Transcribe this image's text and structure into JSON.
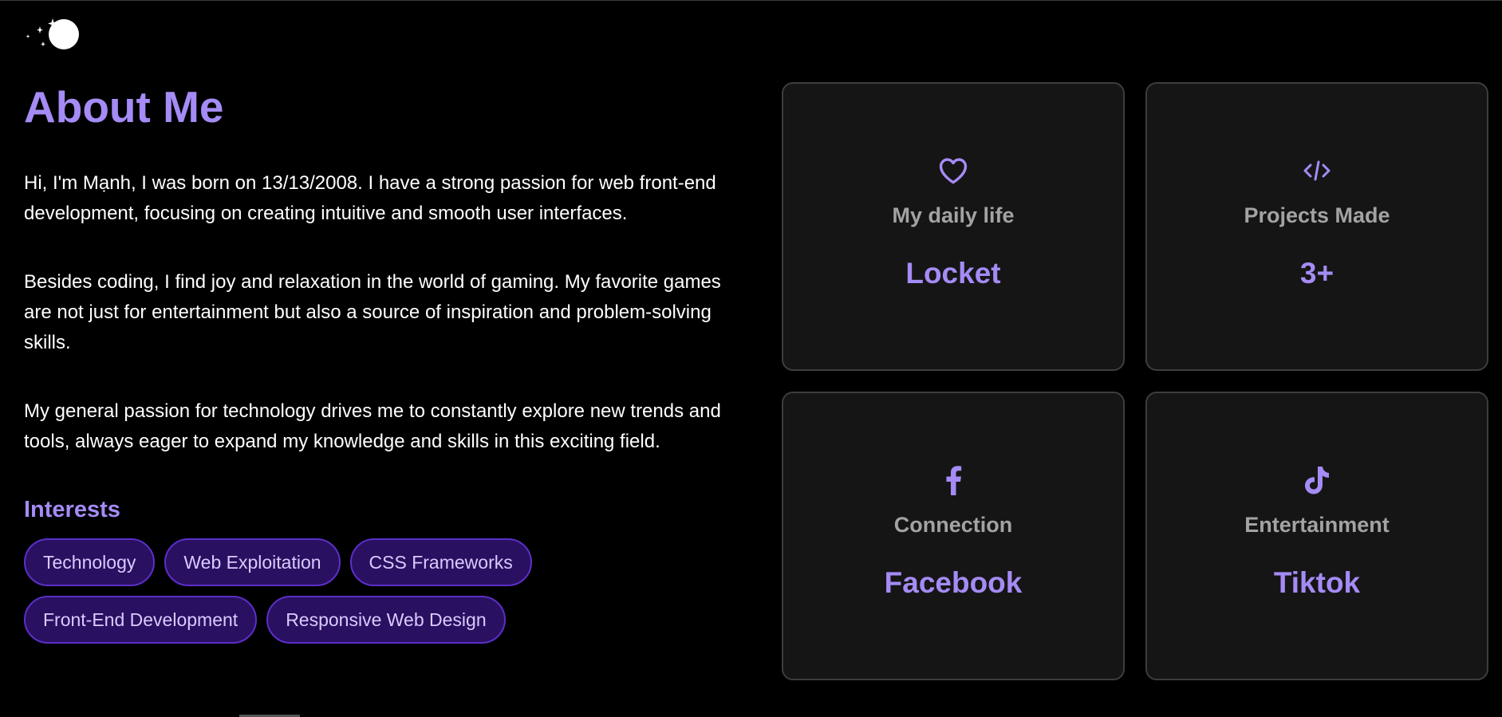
{
  "header": {
    "logo_icon": "moon-stars-icon"
  },
  "about": {
    "title": "About Me",
    "paragraphs": [
      "Hi, I'm Mạnh, I was born on 13/13/2008. I have a strong passion for web front-end development, focusing on creating intuitive and smooth user interfaces.",
      "Besides coding, I find joy and relaxation in the world of gaming. My favorite games are not just for entertainment but also a source of inspiration and problem-solving skills.",
      "My general passion for technology drives me to constantly explore new trends and tools, always eager to expand my knowledge and skills in this exciting field."
    ],
    "interests_title": "Interests",
    "interests": [
      "Technology",
      "Web Exploitation",
      "CSS Frameworks",
      "Front-End Development",
      "Responsive Web Design"
    ]
  },
  "cards": [
    {
      "icon": "heart-icon",
      "label": "My daily life",
      "value": "Locket"
    },
    {
      "icon": "code-icon",
      "label": "Projects Made",
      "value": "3+"
    },
    {
      "icon": "facebook-icon",
      "label": "Connection",
      "value": "Facebook"
    },
    {
      "icon": "tiktok-icon",
      "label": "Entertainment",
      "value": "Tiktok"
    }
  ],
  "colors": {
    "accent": "#a58bf5",
    "background": "#000000",
    "card_background": "#151515",
    "tag_background": "#2a1060",
    "tag_border": "#5b2fc9"
  }
}
